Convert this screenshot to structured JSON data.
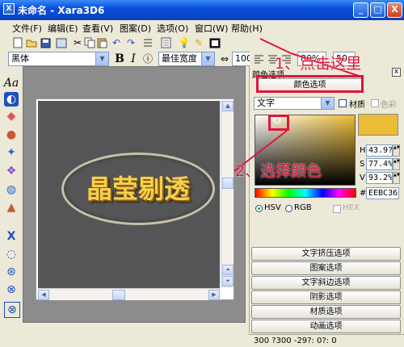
{
  "window": {
    "title": "未命名 - Xara3D6",
    "buttons": {
      "minimize": "_",
      "maximize": "□",
      "close": "X"
    }
  },
  "menu": [
    "文件(F)",
    "编辑(E)",
    "查看(V)",
    "图案(D)",
    "选项(O)",
    "窗口(W)",
    "帮助(H)"
  ],
  "toolbar2": {
    "font": "黑体",
    "bold": "B",
    "italic": "I",
    "width_mode": "最佳宽度",
    "zoom": "100%",
    "spacing1": "80%",
    "spacing2": "50"
  },
  "canvas": {
    "text": "晶莹剔透"
  },
  "panel": {
    "title": "颜色选项",
    "color_options_button": "颜色选项",
    "target_select": "文字",
    "material_label": "材质",
    "tint_label": "色彩",
    "fields": {
      "h_label": "H",
      "h_value": "43.9?",
      "s_label": "S",
      "s_value": "77.4%",
      "v_label": "V",
      "v_value": "93.2%",
      "hex_label": "#",
      "hex_value": "EEBC36"
    },
    "modes": {
      "hsv": "HSV",
      "rgb": "RGB",
      "hex": "HEX"
    },
    "buttons": [
      "文字挤压选项",
      "图案选项",
      "文字斜边选项",
      "阴影选项",
      "材质选项",
      "动画选项"
    ],
    "status": "300 ?300  -29?: 0?: 0"
  },
  "annotations": {
    "step1": "1、点击这里",
    "step2": "2、选择颜色"
  },
  "colors": {
    "selected": "#EEBC36",
    "annotation": "#E0143C"
  }
}
